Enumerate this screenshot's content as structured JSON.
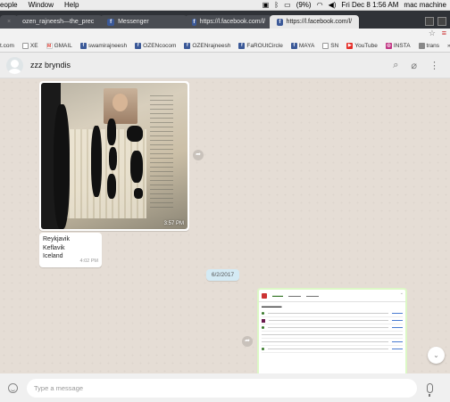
{
  "menubar": {
    "items": [
      "eople",
      "Window",
      "Help"
    ],
    "battery": "(9%)",
    "clock": "Fri Dec 8  1:56 AM",
    "user": "mac machine"
  },
  "tabs": [
    {
      "label": "ozen_rajneesh—the_prec",
      "active": false
    },
    {
      "label": "Messenger",
      "active": false
    },
    {
      "label": "https://l.facebook.com/l/",
      "active": false
    },
    {
      "label": "https://l.facebook.com/l/",
      "active": false
    }
  ],
  "bookmarks": [
    {
      "label": "t.com",
      "icon": ""
    },
    {
      "label": "XE",
      "icon": "doc"
    },
    {
      "label": "GMAIL",
      "icon": "gmail"
    },
    {
      "label": "swamirajneesh",
      "icon": "facebook"
    },
    {
      "label": "OZENcocom",
      "icon": "facebook"
    },
    {
      "label": "OZENrajneesh",
      "icon": "facebook"
    },
    {
      "label": "FaROUtCircle",
      "icon": "facebook"
    },
    {
      "label": "MAYA",
      "icon": "facebook"
    },
    {
      "label": "SN",
      "icon": "doc"
    },
    {
      "label": "YouTube",
      "icon": "youtube"
    },
    {
      "label": "INSTA",
      "icon": "instagram"
    },
    {
      "label": "trans",
      "icon": "generic"
    }
  ],
  "chat": {
    "contact_name": "zzz bryndis"
  },
  "messages": {
    "image": {
      "time": "3:57 PM"
    },
    "text": {
      "lines": [
        "Reykjavik",
        "Keflavik",
        "Iceland"
      ],
      "time": "4:02 PM"
    },
    "date_divider": "6/2/2017"
  },
  "composer": {
    "placeholder": "Type a message"
  },
  "colors": {
    "chat_bg": "#e5ddd5",
    "outgoing_bubble": "#dcf8c6",
    "incoming_bubble": "#ffffff",
    "date_pill": "#d4eaf4"
  }
}
